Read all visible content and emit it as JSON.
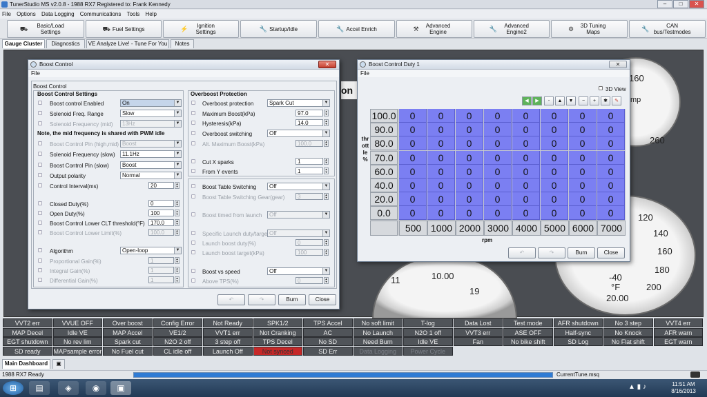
{
  "window": {
    "title": "TunerStudio MS v2.0.8 - 1988 RX7 Registered to: Frank Kennedy"
  },
  "menu": [
    "File",
    "Options",
    "Data Logging",
    "Communications",
    "Tools",
    "Help"
  ],
  "toolbar": [
    {
      "label": "Basic/Load Settings",
      "icon": "car-icon"
    },
    {
      "label": "Fuel Settings",
      "icon": "car-icon"
    },
    {
      "label": "Ignition Settings",
      "icon": "spark-icon"
    },
    {
      "label": "Startup/Idle",
      "icon": "wrench-icon"
    },
    {
      "label": "Accel Enrich",
      "icon": "wrench-icon"
    },
    {
      "label": "Advanced Engine",
      "icon": "hammer-icon"
    },
    {
      "label": "Advanced Engine2",
      "icon": "wrench-icon"
    },
    {
      "label": "3D Tuning Maps",
      "icon": "tuning-icon"
    },
    {
      "label": "CAN bus/Testmodes",
      "icon": "wrench-icon"
    }
  ],
  "tabs": [
    "Gauge Cluster",
    "Diagnostics",
    "VE Analyze Live! - Tune For You",
    "Notes"
  ],
  "gauges": {
    "labels": [
      "160",
      "mp",
      "260",
      "120",
      "140",
      "160",
      "180",
      "200",
      "11",
      "10.00",
      "19",
      "-40",
      "°F",
      "20.00"
    ],
    "partial_title": "on"
  },
  "boost_control": {
    "title": "Boost Control",
    "menu": "File",
    "group_title": "Boost Control",
    "settings_title": "Boost Control Settings",
    "fields": [
      {
        "label": "Boost control Enabled",
        "value": "On"
      },
      {
        "label": "Solenoid Freq. Range",
        "value": "Slow"
      },
      {
        "label": "Solenoid Frequency (mid)",
        "value": "13Hz"
      }
    ],
    "note": "Note, the mid frequency is shared with PWM idle",
    "fields2": [
      {
        "label": "Boost Control Pin (high,mid)",
        "value": "Boost"
      },
      {
        "label": "Solenoid Frequency (slow)",
        "value": "11.1Hz"
      },
      {
        "label": "Boost Control Pin (slow)",
        "value": "Boost"
      },
      {
        "label": "Output polarity",
        "value": "Normal"
      },
      {
        "label": "Control Interval(ms)",
        "value": "20"
      },
      {
        "label": "Closed Duty(%)",
        "value": "0"
      },
      {
        "label": "Open Duty(%)",
        "value": "100"
      },
      {
        "label": "Boost Control Lower CLT threshold(°F)",
        "value": "170.0"
      },
      {
        "label": "Boost Control Lower Limit(%)",
        "value": "100.0"
      },
      {
        "label": "Algorithm",
        "value": "Open-loop"
      },
      {
        "label": "Proportional Gain(%)",
        "value": "1"
      },
      {
        "label": "Integral Gain(%)",
        "value": "1"
      },
      {
        "label": "Differential Gain(%)",
        "value": "1"
      }
    ],
    "overboost_title": "Overboost Protection",
    "overboost": [
      {
        "label": "Overboost protection",
        "value": "Spark Cut"
      },
      {
        "label": "Maximum Boost(kPa)",
        "value": "97.0"
      },
      {
        "label": "Hysteresis(kPa)",
        "value": "14.0"
      },
      {
        "label": "Overboost switching",
        "value": "Off"
      },
      {
        "label": "Alt. Maximum Boost(kPa)",
        "value": "100.0"
      },
      {
        "label": "Cut X sparks",
        "value": "1"
      },
      {
        "label": "From Y events",
        "value": "1"
      }
    ],
    "table_switch": [
      {
        "label": "Boost Table Switching",
        "value": "Off"
      },
      {
        "label": "Boost Table Switching Gear(gear)",
        "value": "3"
      },
      {
        "label": "Boost timed from launch",
        "value": "Off"
      },
      {
        "label": "Specific Launch duty/target",
        "value": "Off"
      },
      {
        "label": "Launch boost duty(%)",
        "value": "0"
      },
      {
        "label": "Launch boost target(kPa)",
        "value": "100"
      },
      {
        "label": "Boost vs speed",
        "value": "Off"
      },
      {
        "label": "Above TPS(%)",
        "value": "0"
      }
    ],
    "burn": "Burn",
    "close": "Close"
  },
  "duty_table": {
    "title": "Boost Control Duty 1",
    "menu": "File",
    "view3d": "3D View",
    "y_axis_label": "throttle %",
    "y_values": [
      "100.0",
      "90.0",
      "80.0",
      "70.0",
      "60.0",
      "40.0",
      "20.0",
      "0.0"
    ],
    "x_values": [
      "500",
      "1000",
      "2000",
      "3000",
      "4000",
      "5000",
      "6000",
      "7000"
    ],
    "x_axis_label": "rpm",
    "cells": [
      [
        "0",
        "0",
        "0",
        "0",
        "0",
        "0",
        "0",
        "0"
      ],
      [
        "0",
        "0",
        "0",
        "0",
        "0",
        "0",
        "0",
        "0"
      ],
      [
        "0",
        "0",
        "0",
        "0",
        "0",
        "0",
        "0",
        "0"
      ],
      [
        "0",
        "0",
        "0",
        "0",
        "0",
        "0",
        "0",
        "0"
      ],
      [
        "0",
        "0",
        "0",
        "0",
        "0",
        "0",
        "0",
        "0"
      ],
      [
        "0",
        "0",
        "0",
        "0",
        "0",
        "0",
        "0",
        "0"
      ],
      [
        "0",
        "0",
        "0",
        "0",
        "0",
        "0",
        "0",
        "0"
      ],
      [
        "0",
        "0",
        "0",
        "0",
        "0",
        "0",
        "0",
        "0"
      ]
    ],
    "cell_color": "#7b7ff2",
    "burn": "Burn",
    "close": "Close"
  },
  "status_indicators": [
    [
      "VVT2 err",
      "VVUE OFF",
      "Over boost",
      "Config Error",
      "Not Ready",
      "SPK1/2",
      "TPS Accel",
      "No soft limit",
      "T-log",
      "Data Lost",
      "Test mode",
      "AFR shutdown",
      "No 3 step",
      "VVT4 err"
    ],
    [
      "MAP Decel",
      "Idle VE",
      "MAP Accel",
      "VE1/2",
      "VVT1 err",
      "Not Cranking",
      "AC",
      "No Launch",
      "N2O 1 off",
      "VVT3 err",
      "ASE OFF",
      "Half-sync",
      "No Knock",
      "AFR warn"
    ],
    [
      "EGT shutdown",
      "No rev lim",
      "Spark cut",
      "N2O 2 off",
      "3 step off",
      "TPS Decel",
      "No SD",
      "Need Burn",
      "Idle VE",
      "Fan",
      "No bike shift",
      "SD Log",
      "No Flat shift",
      "EGT warn"
    ],
    [
      "SD ready",
      "MAPsample error",
      "No Fuel cut",
      "CL idle off",
      "Launch Off",
      "Not synced",
      "SD Err",
      "Data Logging",
      "Power Cycle"
    ]
  ],
  "bottom_tab": "Main Dashboard",
  "status": {
    "left": "1988 RX7 Ready",
    "right": "CurrentTune.msq"
  },
  "clock": {
    "time": "11:51 AM",
    "date": "8/16/2013"
  }
}
